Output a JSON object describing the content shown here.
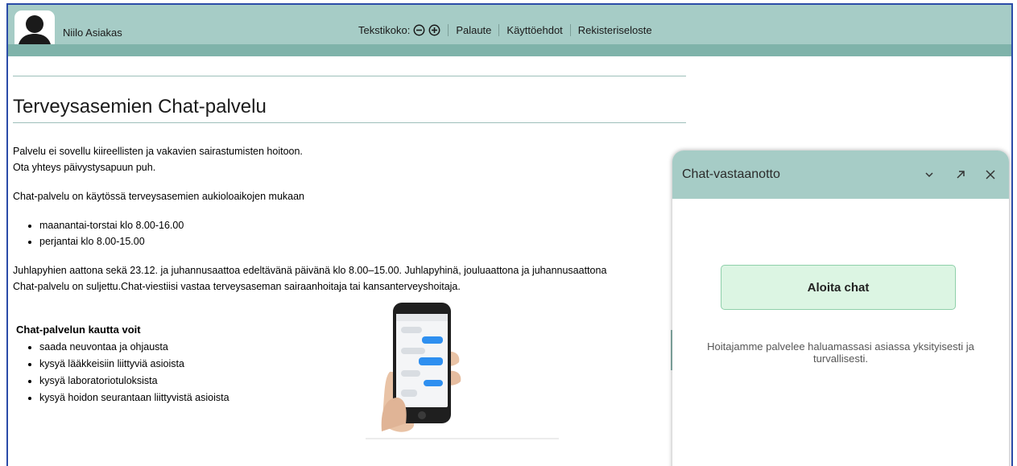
{
  "header": {
    "user_name": "Niilo Asiakas",
    "text_size_label": "Tekstikoko:",
    "links": [
      "Palaute",
      "Käyttöehdot",
      "Rekisteriseloste"
    ]
  },
  "main": {
    "title": "Terveysasemien Chat-palvelu",
    "intro_line1": "Palvelu ei sovellu kiireellisten ja vakavien sairastumisten hoitoon.",
    "intro_line2": "Ota yhteys päivystysapuun puh.",
    "availability": "Chat-palvelu on käytössä terveysasemien aukioloaikojen mukaan",
    "hours": [
      "maanantai-torstai klo 8.00-16.00",
      "perjantai klo 8.00-15.00"
    ],
    "holiday_line1": "Juhlapyhien aattona sekä 23.12. ja juhannusaattoa edeltävänä päivänä klo 8.00–15.00. Juhlapyhinä, jouluaattona ja juhannusaattona",
    "holiday_line2": "Chat-palvelu on suljettu.Chat-viestiisi vastaa terveysaseman sairaanhoitaja tai kansanterveyshoitaja.",
    "actions_heading": "Chat-palvelun kautta voit",
    "actions": [
      "saada neuvontaa ja ohjausta",
      "kysyä lääkkeisiin liittyviä asioista",
      "kysyä laboratoriotuloksista",
      "kysyä hoidon seurantaan liittyvistä asioista"
    ]
  },
  "chat": {
    "title": "Chat-vastaanotto",
    "start_button": "Aloita chat",
    "description": "Hoitajamme palvelee haluamassasi asiassa yksityisesti ja turvallisesti."
  },
  "colors": {
    "header_bg": "#a6ccc6",
    "header_strip": "#7fb3aa",
    "start_button_bg": "#dcf5e3",
    "frame_border": "#2b4ca8"
  }
}
